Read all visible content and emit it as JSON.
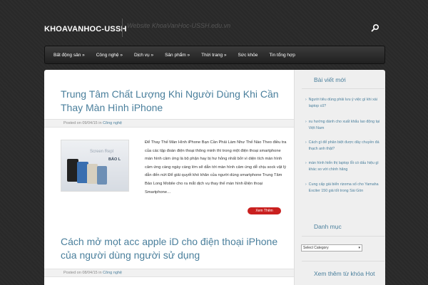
{
  "header": {
    "site_title": "KHOAVANHOC-USSH",
    "site_description": "Website KhoaVanHoc-USSH.edu.vn",
    "search_icon": "search-icon"
  },
  "nav": {
    "items": [
      {
        "label": "Bất động sản »"
      },
      {
        "label": "Công nghệ »"
      },
      {
        "label": "Dịch vụ »"
      },
      {
        "label": "Sản phẩm »"
      },
      {
        "label": "Thời trang »"
      },
      {
        "label": "Sức khỏe"
      },
      {
        "label": "Tin tổng hợp"
      }
    ]
  },
  "posts": [
    {
      "title": "Trung Tâm Chất Lượng Khi Người Dùng Khi Cần Thay Màn Hình iPhone",
      "posted_on": "Posted on",
      "date": "09/04/15",
      "in": "in",
      "category": "Công nghệ",
      "thumb_text_1": "Screen Repl",
      "thumb_text_2": "BẢO L",
      "excerpt": "Để Thay Thế Màn Hình iPhone Bạn Cần Phải Làm Như Thế Nào Theo điều tra của các tập đoàn điện thoại thông minh thì trong một điện thoại smartphone màn hình cảm ứng là bộ phận hay bị hư hỏng nhất bởi vì diện tích màn hình cảm ứng càng ngày càng lớn sẽ dẫn tới màn hình cảm ứng dễ chịu sock vật lý dẫn đến nứt Để giải quyết khó khăn của người dùng smartphone Trung Tâm Bảo Long Mobile cho ra mắt dịch vụ thay thế màn hình Điện thoại Smartphone…",
      "read_more": "Xem Thêm"
    },
    {
      "title": "Cách mở mọt acc apple iD cho điện thoại iPhone của người dùng người sử dụng",
      "posted_on": "Posted on",
      "date": "08/04/15",
      "in": "in",
      "category": "Công nghệ"
    }
  ],
  "sidebar": {
    "recent_title": "Bài viết mới",
    "recent": [
      {
        "text": "Người tiêu dùng phải lưu ý việc gì khi xài laptop cũ?"
      },
      {
        "text": "xu hướng dành cho xuất khẩu lao động tại Việt Nam"
      },
      {
        "text": "Cách gì để phân biệt được dây chuyền đá thạch anh thật?"
      },
      {
        "text": "màn hình hiển thị laptop lỗi có dấu hiệu gì khác so với chính hãng"
      },
      {
        "text": "Cung cấp giá biển rizoma số cho Yamaha Exciter 150 giá tốt trong Sài Gòn"
      }
    ],
    "categories_title": "Danh mục",
    "categories_select": "Select Category",
    "tags_title": "Xem thêm từ khóa Hot"
  }
}
